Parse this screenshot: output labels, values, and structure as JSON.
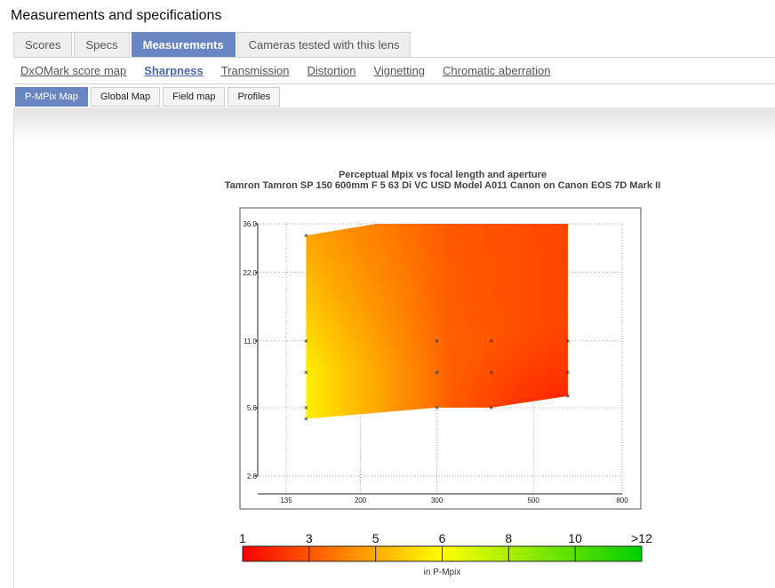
{
  "page": {
    "title": "Measurements and specifications"
  },
  "main_tabs": [
    {
      "label": "Scores",
      "active": false
    },
    {
      "label": "Specs",
      "active": false
    },
    {
      "label": "Measurements",
      "active": true
    },
    {
      "label": "Cameras tested with this lens",
      "active": false
    }
  ],
  "sub_links": [
    {
      "label": "DxOMark score map",
      "active": false
    },
    {
      "label": "Sharpness",
      "active": true
    },
    {
      "label": "Transmission",
      "active": false
    },
    {
      "label": "Distortion",
      "active": false
    },
    {
      "label": "Vignetting",
      "active": false
    },
    {
      "label": "Chromatic aberration",
      "active": false
    }
  ],
  "view_tabs": [
    {
      "label": "P-MPix Map",
      "active": true
    },
    {
      "label": "Global Map",
      "active": false
    },
    {
      "label": "Field map",
      "active": false
    },
    {
      "label": "Profiles",
      "active": false
    }
  ],
  "colors": {
    "accent": "#6a86c2",
    "scale": [
      "#ff0000",
      "#ff6000",
      "#ffc000",
      "#ffff00",
      "#c0ff00",
      "#60e000",
      "#00c000"
    ]
  },
  "chart_data": {
    "type": "heatmap",
    "title": "Perceptual Mpix vs focal length and aperture",
    "subtitle": "Tamron Tamron SP 150 600mm F 5 63 Di VC USD Model A011 Canon on Canon EOS 7D Mark II",
    "x_scale": "log",
    "y_scale": "log",
    "x_ticks": [
      "135",
      "200",
      "300",
      "500",
      "800"
    ],
    "y_ticks": [
      "36.0",
      "22.0",
      "11.0",
      "5.6",
      "2.8"
    ],
    "xlim": [
      135,
      800
    ],
    "ylim": [
      2.8,
      36
    ],
    "grid": true,
    "measurement_points": [
      {
        "focal": 150,
        "aperture": 32
      },
      {
        "focal": 150,
        "aperture": 11
      },
      {
        "focal": 150,
        "aperture": 8
      },
      {
        "focal": 150,
        "aperture": 5.6
      },
      {
        "focal": 150,
        "aperture": 5
      },
      {
        "focal": 300,
        "aperture": 11
      },
      {
        "focal": 300,
        "aperture": 8
      },
      {
        "focal": 300,
        "aperture": 5.6
      },
      {
        "focal": 400,
        "aperture": 11
      },
      {
        "focal": 400,
        "aperture": 8
      },
      {
        "focal": 400,
        "aperture": 5.6
      },
      {
        "focal": 600,
        "aperture": 11
      },
      {
        "focal": 600,
        "aperture": 8
      },
      {
        "focal": 600,
        "aperture": 6.3
      }
    ],
    "legend": {
      "labels": [
        "1",
        "3",
        "5",
        "6",
        "8",
        "10",
        ">12"
      ],
      "unit": "in P-Mpix"
    }
  }
}
